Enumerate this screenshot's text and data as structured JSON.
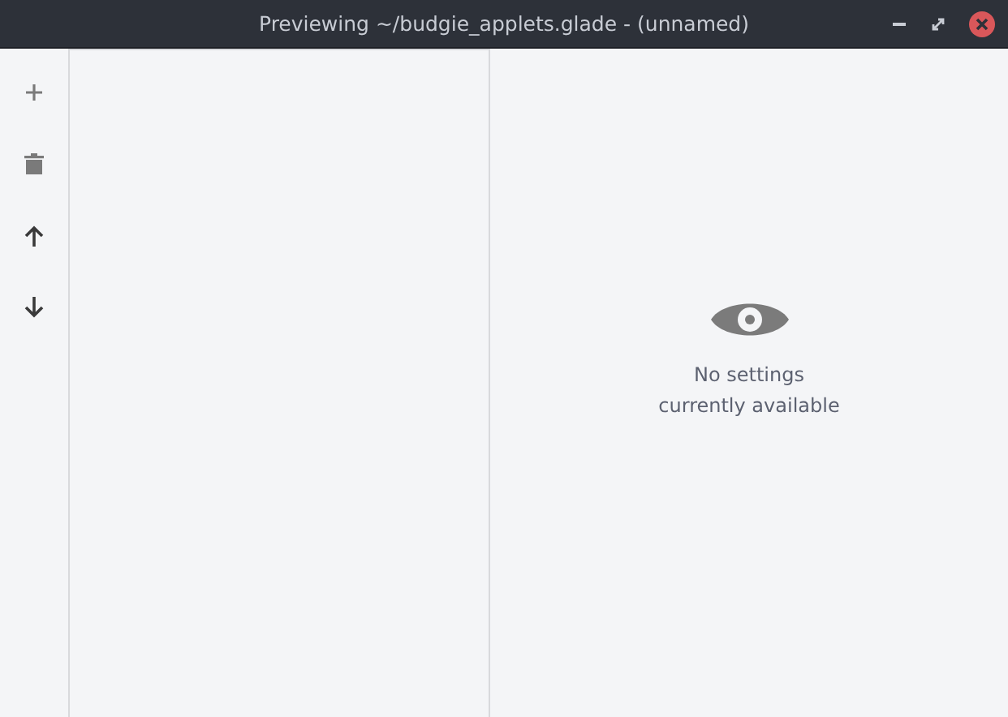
{
  "window": {
    "title": "Previewing ~/budgie_applets.glade - (unnamed)"
  },
  "toolbar": [
    {
      "kind": "add",
      "disabled": true
    },
    {
      "kind": "delete",
      "disabled": true
    },
    {
      "kind": "up",
      "disabled": false
    },
    {
      "kind": "down",
      "disabled": false
    }
  ],
  "placeholder": {
    "lines": [
      "No settings",
      "currently available"
    ]
  }
}
